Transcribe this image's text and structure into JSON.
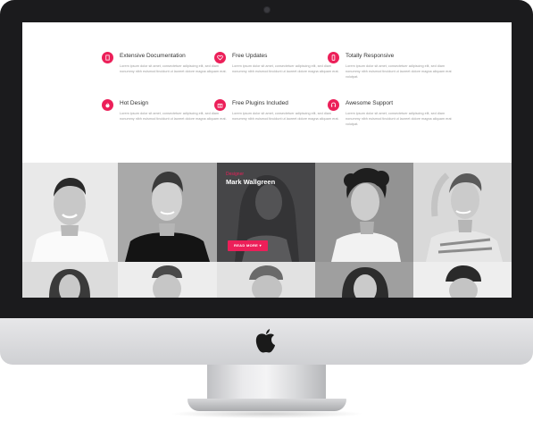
{
  "features": [
    {
      "title": "Extensive Documentation",
      "icon": "document-icon",
      "desc": "Lorem ipsum dolor sit amet, consectetuer adipiscing elit, sed diam nonummy nibh euismod tincidunt ut laoreet dolore magna aliquam erat."
    },
    {
      "title": "Free Updates",
      "icon": "heart-icon",
      "desc": "Lorem ipsum dolor sit amet, consectetuer adipiscing elit, sed diam nonummy nibh euismod tincidunt ut laoreet dolore magna aliquam erat."
    },
    {
      "title": "Totally Responsive",
      "icon": "mobile-icon",
      "desc": "Lorem ipsum dolor sit amet, consectetuer adipiscing elit, sed diam nonummy nibh euismod tincidunt ut laoreet dolore magna aliquam erat volutpat."
    },
    {
      "title": "Hot Design",
      "icon": "flame-icon",
      "desc": "Lorem ipsum dolor sit amet, consectetuer adipiscing elit, sed diam nonummy nibh euismod tincidunt ut laoreet dolore magna aliquam erat."
    },
    {
      "title": "Free Plugins Included",
      "icon": "gift-icon",
      "desc": "Lorem ipsum dolor sit amet, consectetuer adipiscing elit, sed diam nonummy nibh euismod tincidunt ut laoreet dolore magna aliquam erat."
    },
    {
      "title": "Awesome Support",
      "icon": "headset-icon",
      "desc": "Lorem ipsum dolor sit amet, consectetuer adipiscing elit, sed diam nonummy nibh euismod tincidunt ut laoreet dolore magna aliquam erat volutpat."
    }
  ],
  "team": {
    "featured_role": "Designer",
    "featured_name": "Mark Wallgreen",
    "read_more_label": "READ MORE"
  },
  "colors": {
    "accent": "#ec1f59",
    "bezel": "#1b1b1d",
    "overlay": "#37373a"
  }
}
